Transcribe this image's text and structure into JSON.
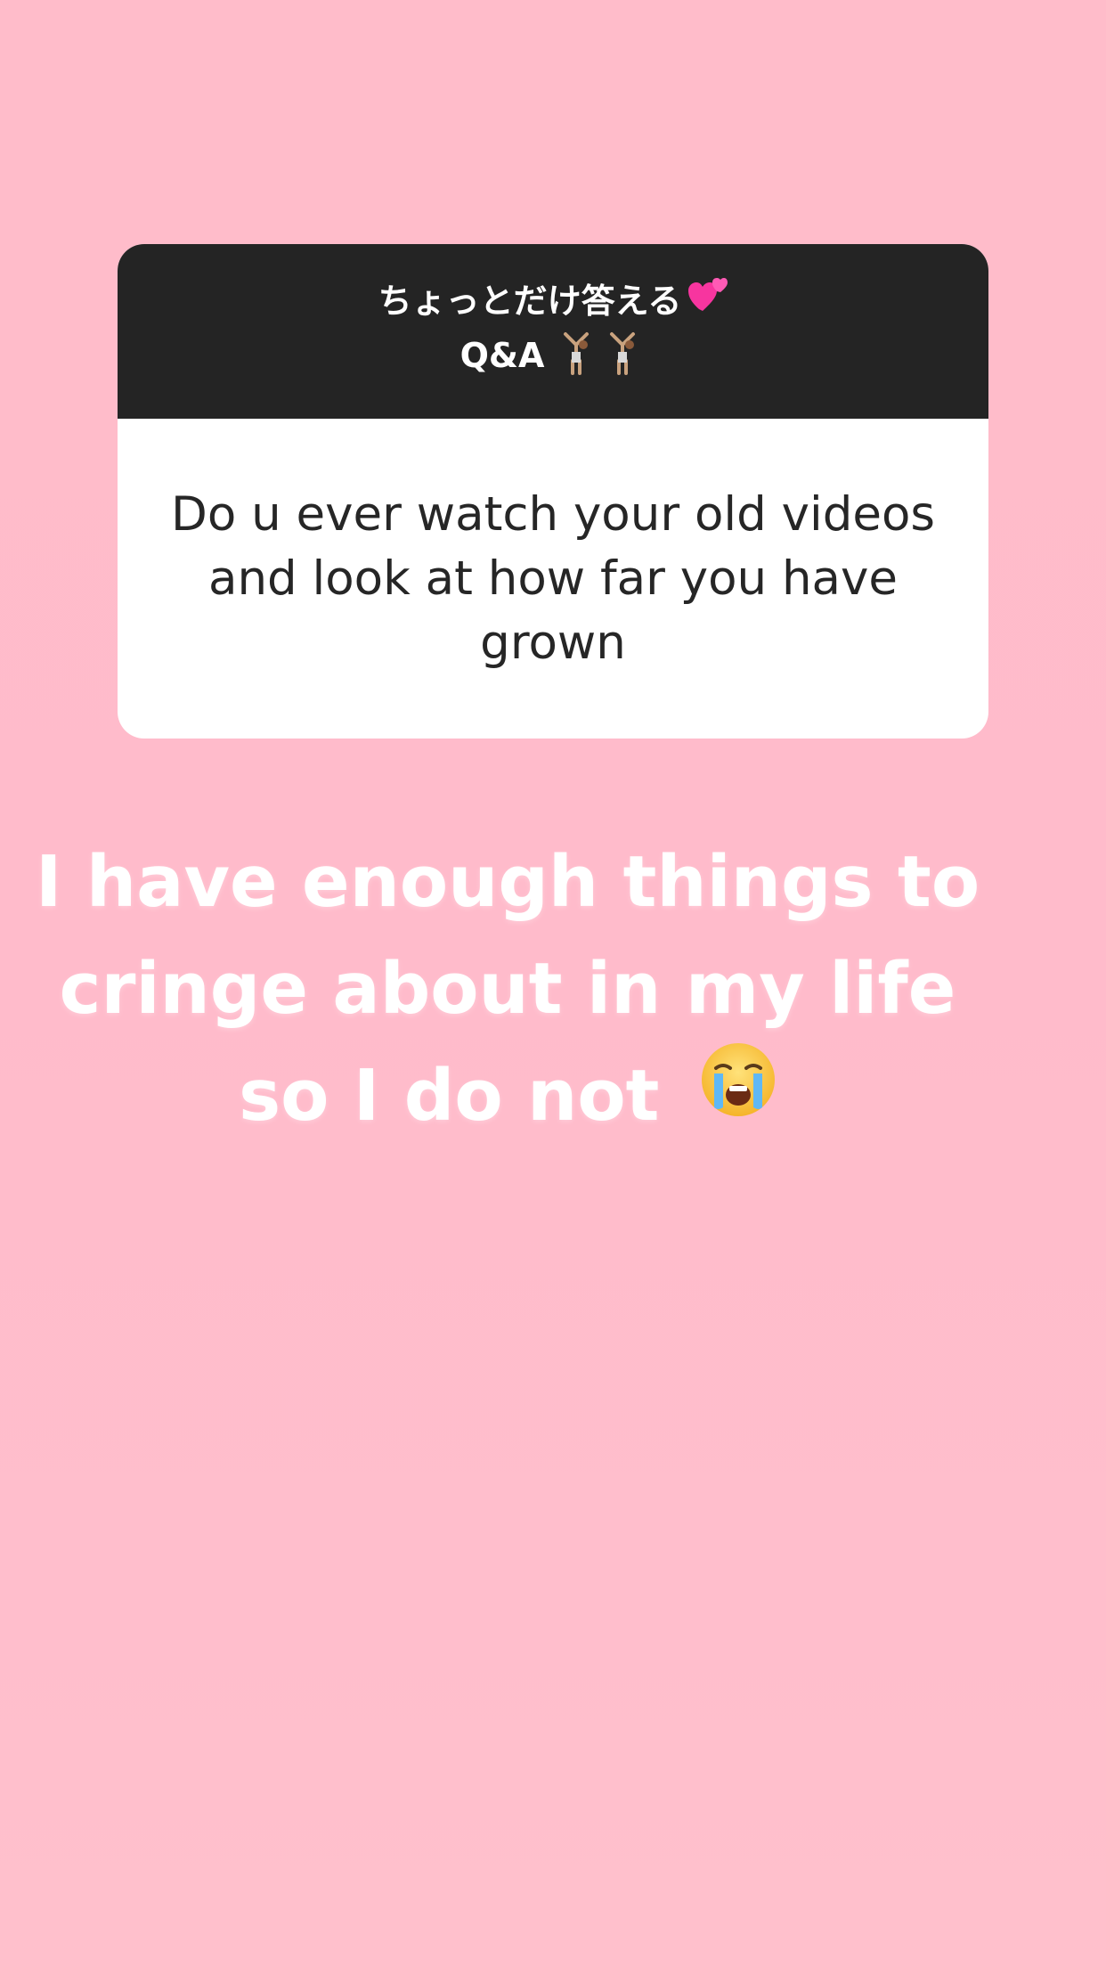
{
  "question_sticker": {
    "title_line1": "ちょっとだけ答える",
    "title_line2": "Q&A",
    "title_emoji_heart": "two-hearts-icon",
    "title_emoji_gymnast": "cartwheel-icon",
    "question": "Do u ever watch your old videos and look at how far you have grown",
    "colors": {
      "header_bg": "#242424",
      "body_bg": "#ffffff"
    }
  },
  "answer_text": {
    "line1": "I have enough things to",
    "line2": "cringe about in my life",
    "line3": "so I do not",
    "emoji": "loudly-crying-face-icon"
  },
  "background": {
    "color": "#ffbccb"
  }
}
